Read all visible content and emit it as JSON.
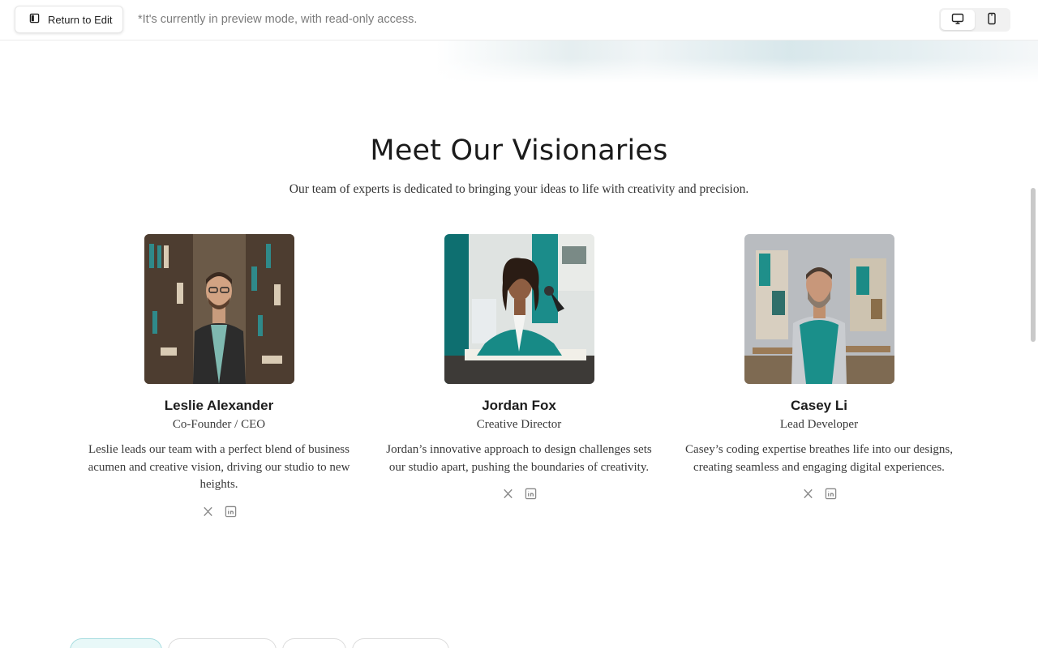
{
  "toolbar": {
    "return_label": "Return to Edit",
    "preview_note": "*It's currently in preview mode, with read-only access."
  },
  "section": {
    "title": "Meet Our Visionaries",
    "subtitle": "Our team of experts is dedicated to bringing your ideas to life with creativity and precision."
  },
  "team": [
    {
      "name": "Leslie Alexander",
      "role": "Co-Founder / CEO",
      "bio": "Leslie leads our team with a perfect blend of business acumen and creative vision, driving our studio to new heights."
    },
    {
      "name": "Jordan Fox",
      "role": "Creative Director",
      "bio": "Jordan’s innovative approach to design challenges sets our studio apart, pushing the boundaries of creativity."
    },
    {
      "name": "Casey Li",
      "role": "Lead Developer",
      "bio": "Casey’s coding expertise breathes life into our designs, creating seamless and engaging digital experiences."
    }
  ],
  "icons": {
    "return": "sidebar-panel-icon",
    "desktop": "monitor-icon",
    "mobile": "phone-icon",
    "social_1": "x-icon",
    "social_2": "linkedin-icon"
  },
  "colors": {
    "accent_teal": "#0f8f8f",
    "text": "#1b1b1b",
    "muted": "#7b7b7b",
    "pill_active_bg": "#e8f8f8"
  }
}
